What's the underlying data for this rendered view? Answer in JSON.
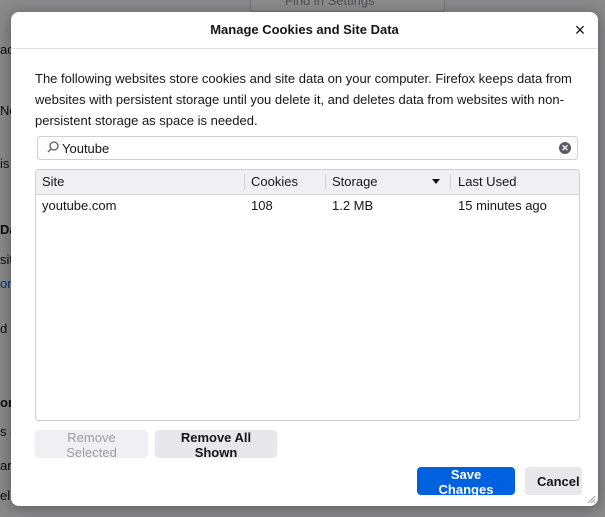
{
  "background": {
    "find_placeholder": "Find in Settings"
  },
  "dialog": {
    "title": "Manage Cookies and Site Data",
    "close_symbol": "×",
    "description": "The following websites store cookies and site data on your computer. Firefox keeps data from websites with persistent storage until you delete it, and deletes data from websites with non-persistent storage as space is needed.",
    "search": {
      "value": "Youtube",
      "icon": "search-icon",
      "clear_icon": "clear-icon"
    },
    "table": {
      "columns": [
        "Site",
        "Cookies",
        "Storage",
        "Last Used"
      ],
      "sorted_column": "Storage",
      "rows": [
        {
          "site": "youtube.com",
          "cookies": "108",
          "storage": "1.2 MB",
          "last_used": "15 minutes ago"
        }
      ]
    },
    "buttons": {
      "remove_selected": "Remove Selected",
      "remove_all_shown": "Remove All Shown",
      "save_changes": "Save Changes",
      "cancel": "Cancel"
    },
    "colors": {
      "primary": "#0061e0",
      "text": "#15141a"
    }
  }
}
